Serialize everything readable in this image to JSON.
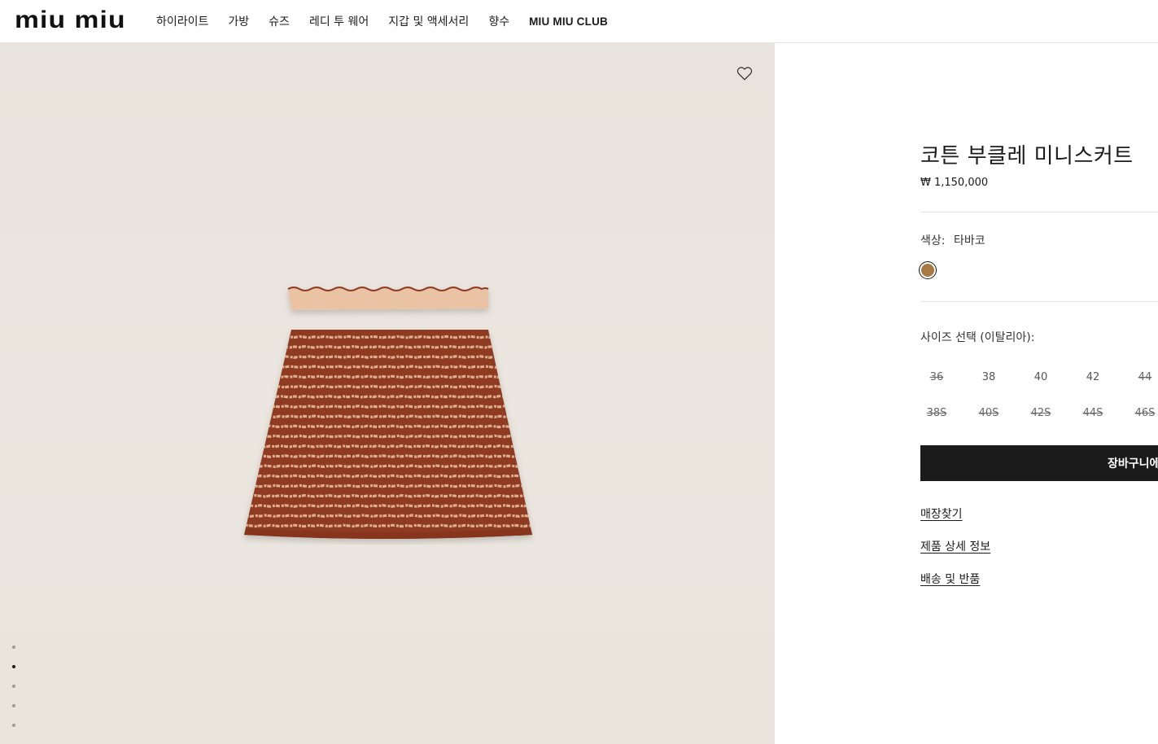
{
  "header": {
    "logo": "miu miu",
    "nav": [
      {
        "label": "하이라이트"
      },
      {
        "label": "가방"
      },
      {
        "label": "슈즈"
      },
      {
        "label": "레디 투 웨어"
      },
      {
        "label": "지갑 및 액세서리"
      },
      {
        "label": "향수"
      },
      {
        "label": "MIU MIU CLUB"
      }
    ]
  },
  "gallery": {
    "wishlist_icon": "heart-outline-icon",
    "image_description_hidden": "",
    "dot_count": 5,
    "active_dot": 2
  },
  "product": {
    "title": "코튼 부클레 미니스커트",
    "price": "₩ 1,150,000",
    "color_label": "색상:",
    "color_value": "타바코",
    "swatch_color": "#a97a45",
    "size_label": "사이즈 선택 (이탈리아):",
    "sizes_row1": [
      {
        "label": "36",
        "sold_out": true
      },
      {
        "label": "38",
        "sold_out": false
      },
      {
        "label": "40",
        "sold_out": false
      },
      {
        "label": "42",
        "sold_out": false
      },
      {
        "label": "44",
        "sold_out": true
      }
    ],
    "sizes_row2": [
      {
        "label": "38S",
        "sold_out": true
      },
      {
        "label": "40S",
        "sold_out": true
      },
      {
        "label": "42S",
        "sold_out": true
      },
      {
        "label": "44S",
        "sold_out": true
      },
      {
        "label": "46S",
        "sold_out": true
      }
    ],
    "add_to_cart": "장바구니에",
    "links": {
      "store_finder": "매장찾기",
      "product_details": "제품 상세 정보",
      "shipping_returns": "배송 및 반품"
    }
  }
}
